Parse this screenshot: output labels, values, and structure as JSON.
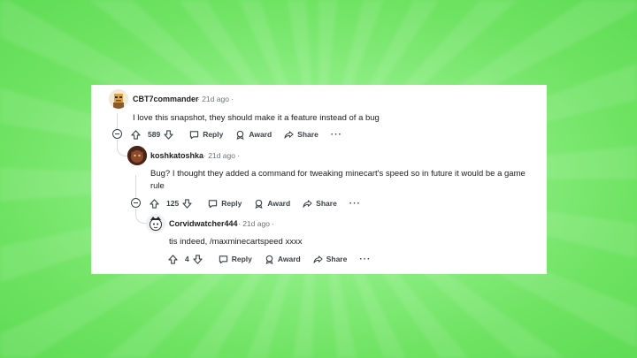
{
  "comments": [
    {
      "username": "CBT7commander",
      "age": "· 21d ago ·",
      "text": "I love this snapshot, they should make it a feature instead of a bug",
      "votes": "589",
      "reply": "Reply",
      "award": "Award",
      "share": "Share",
      "more": "···"
    },
    {
      "username": "koshkatoshka",
      "age": "· 21d ago ·",
      "text": "Bug? I thought they added a command for tweaking minecart's speed so in future it would be a game rule",
      "votes": "125",
      "reply": "Reply",
      "award": "Award",
      "share": "Share",
      "more": "···"
    },
    {
      "username": "Corvidwatcher444",
      "age": "· 21d ago ·",
      "text": "tis indeed, /maxminecartspeed xxxx",
      "votes": "4",
      "reply": "Reply",
      "award": "Award",
      "share": "Share",
      "more": "···"
    }
  ],
  "colors": {
    "background": "#6fe363",
    "card": "#ffffff",
    "text": "#1c1c1c",
    "muted": "#6b7378"
  }
}
